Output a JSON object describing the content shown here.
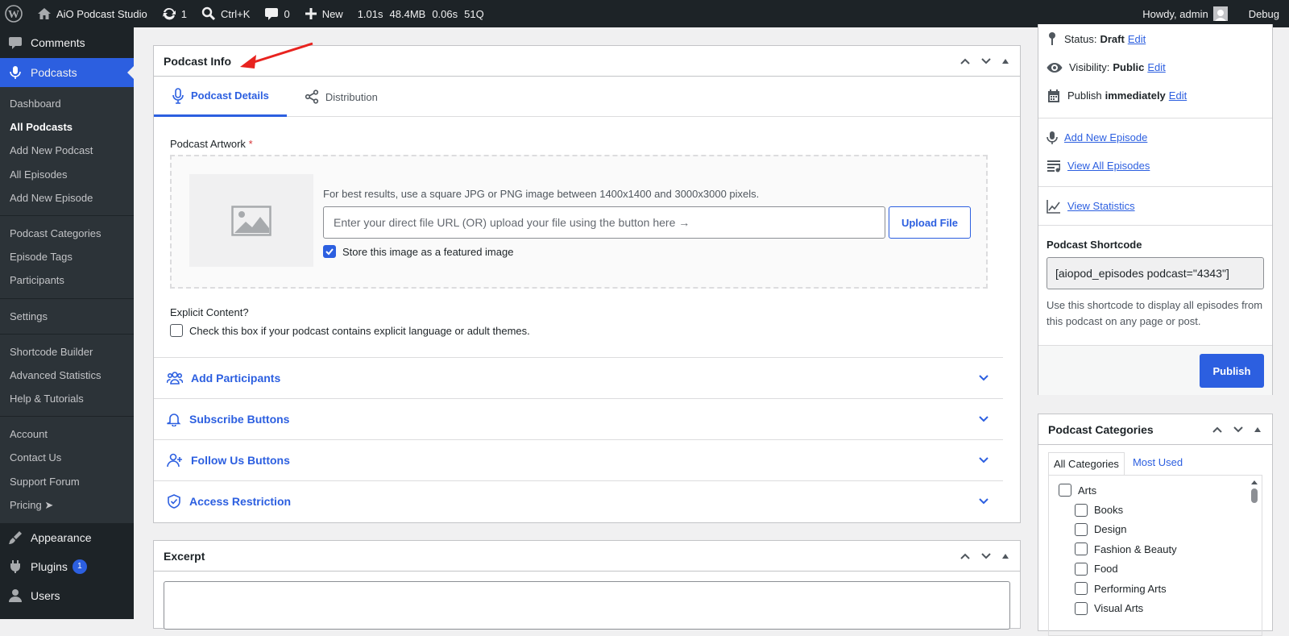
{
  "adminbar": {
    "site_name": "AiO Podcast Studio",
    "updates_count": "1",
    "search_shortcut": "Ctrl+K",
    "comments_count": "0",
    "new_label": "New",
    "debug_stats": [
      "1.01s",
      "48.4MB",
      "0.06s",
      "51Q"
    ],
    "howdy": "Howdy, admin",
    "debug": "Debug"
  },
  "sidebar": {
    "comments": "Comments",
    "podcasts": "Podcasts",
    "submenu": {
      "group1": [
        "Dashboard",
        "All Podcasts",
        "Add New Podcast",
        "All Episodes",
        "Add New Episode"
      ],
      "group2": [
        "Podcast Categories",
        "Episode Tags",
        "Participants"
      ],
      "group3": [
        "Settings"
      ],
      "group4": [
        "Shortcode Builder",
        "Advanced Statistics",
        "Help & Tutorials"
      ],
      "group5": [
        "Account",
        "Contact Us",
        "Support Forum",
        "Pricing ➤"
      ]
    },
    "appearance": "Appearance",
    "plugins": "Plugins",
    "plugins_badge": "1",
    "users": "Users"
  },
  "podcast_info": {
    "title": "Podcast Info",
    "tabs": [
      "Podcast Details",
      "Distribution"
    ],
    "artwork_label": "Podcast Artwork",
    "required_mark": "*",
    "hint": "For best results, use a square JPG or PNG image between 1400x1400 and 3000x3000 pixels.",
    "url_placeholder": "Enter your direct file URL (OR) upload your file using the button here →",
    "upload_button": "Upload File",
    "featured_label": "Store this image as a featured image",
    "explicit_heading": "Explicit Content?",
    "explicit_label": "Check this box if your podcast contains explicit language or adult themes.",
    "accordions": [
      "Add Participants",
      "Subscribe Buttons",
      "Follow Us Buttons",
      "Access Restriction"
    ]
  },
  "excerpt": {
    "title": "Excerpt"
  },
  "publish_box": {
    "status_label": "Status:",
    "status_value": "Draft",
    "visibility_label": "Visibility:",
    "visibility_value": "Public",
    "publish_label": "Publish",
    "publish_value": "immediately",
    "edit": "Edit",
    "add_new_episode": "Add New Episode",
    "view_all_episodes": "View All Episodes",
    "view_statistics": "View Statistics",
    "shortcode_heading": "Podcast Shortcode",
    "shortcode_value": "[aiopod_episodes podcast=\"4343\"]",
    "shortcode_help": "Use this shortcode to display all episodes from this podcast on any page or post.",
    "publish_button": "Publish"
  },
  "categories": {
    "title": "Podcast Categories",
    "tabs": [
      "All Categories",
      "Most Used"
    ],
    "items": [
      "Arts",
      "Books",
      "Design",
      "Fashion & Beauty",
      "Food",
      "Performing Arts",
      "Visual Arts"
    ]
  },
  "colors": {
    "accent": "#2c5fe0",
    "adminbar_bg": "#1d2327",
    "annotation_arrow": "#e8231f"
  }
}
